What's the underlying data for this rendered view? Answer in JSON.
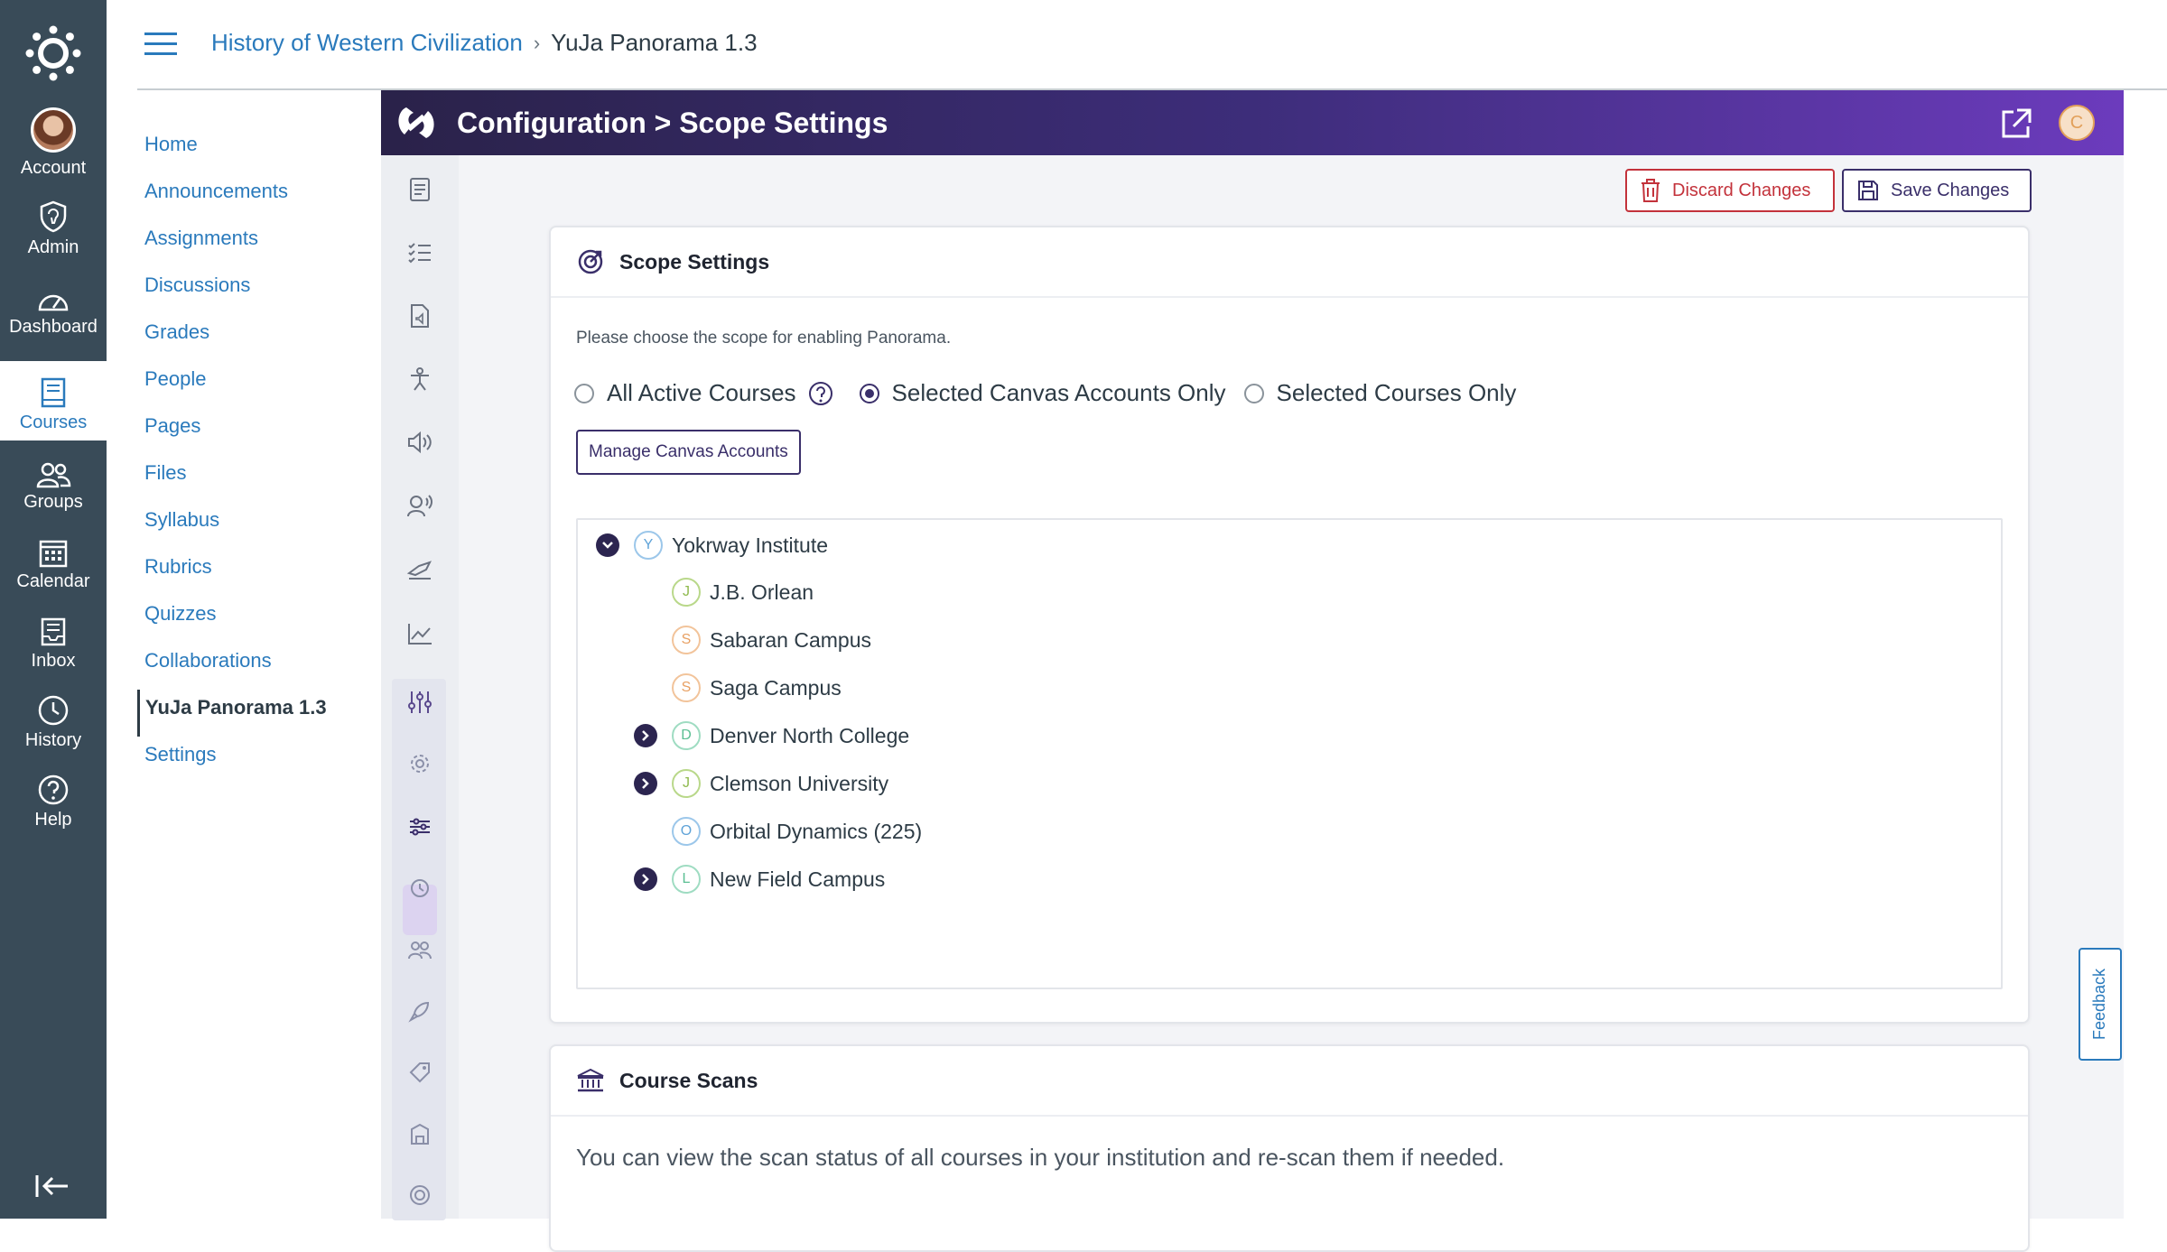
{
  "global_nav": {
    "items": [
      {
        "label": "Account",
        "icon": "account-avatar"
      },
      {
        "label": "Admin",
        "icon": "shield-icon"
      },
      {
        "label": "Dashboard",
        "icon": "dashboard-icon"
      },
      {
        "label": "Courses",
        "icon": "book-icon"
      },
      {
        "label": "Groups",
        "icon": "groups-icon"
      },
      {
        "label": "Calendar",
        "icon": "calendar-icon"
      },
      {
        "label": "Inbox",
        "icon": "inbox-icon"
      },
      {
        "label": "History",
        "icon": "clock-icon"
      },
      {
        "label": "Help",
        "icon": "help-icon"
      }
    ],
    "active": "Courses"
  },
  "breadcrumb": {
    "course": "History of Western Civilization",
    "separator": "›",
    "current": "YuJa Panorama 1.3"
  },
  "course_nav": {
    "items": [
      "Home",
      "Announcements",
      "Assignments",
      "Discussions",
      "Grades",
      "People",
      "Pages",
      "Files",
      "Syllabus",
      "Rubrics",
      "Quizzes",
      "Collaborations",
      "YuJa Panorama 1.3",
      "Settings"
    ],
    "active": "YuJa Panorama 1.3"
  },
  "tool": {
    "title": "Configuration > Scope Settings",
    "user_initial": "C",
    "discard_label": "Discard Changes",
    "save_label": "Save Changes"
  },
  "scope": {
    "title": "Scope Settings",
    "description": "Please choose the scope for enabling Panorama.",
    "options": [
      "All Active Courses",
      "Selected Canvas Accounts Only",
      "Selected Courses Only"
    ],
    "selected": "Selected Canvas Accounts Only",
    "manage_label": "Manage Canvas Accounts"
  },
  "tree": {
    "root": {
      "letter": "Y",
      "label": "Yokrway Institute",
      "expanded": true
    },
    "children": [
      {
        "letter": "J",
        "label": "J.B. Orlean",
        "expandable": false
      },
      {
        "letter": "S",
        "label": "Sabaran Campus",
        "expandable": false
      },
      {
        "letter": "S",
        "label": "Saga Campus",
        "expandable": false
      },
      {
        "letter": "D",
        "label": "Denver North College",
        "expandable": true
      },
      {
        "letter": "J",
        "label": "Clemson University",
        "expandable": true
      },
      {
        "letter": "O",
        "label": "Orbital Dynamics (225)",
        "expandable": false
      },
      {
        "letter": "L",
        "label": "New Field Campus",
        "expandable": true
      }
    ]
  },
  "course_scans": {
    "title": "Course Scans",
    "description": "You can view the scan status of all courses in your institution and re-scan them if needed."
  },
  "feedback_label": "Feedback",
  "colors": {
    "global_nav_bg": "#394b58",
    "link": "#2a7abc",
    "tool_header_start": "#2a2249",
    "tool_header_end": "#6c3bbd",
    "discard": "#c3323b",
    "primary": "#3a2f6a"
  }
}
